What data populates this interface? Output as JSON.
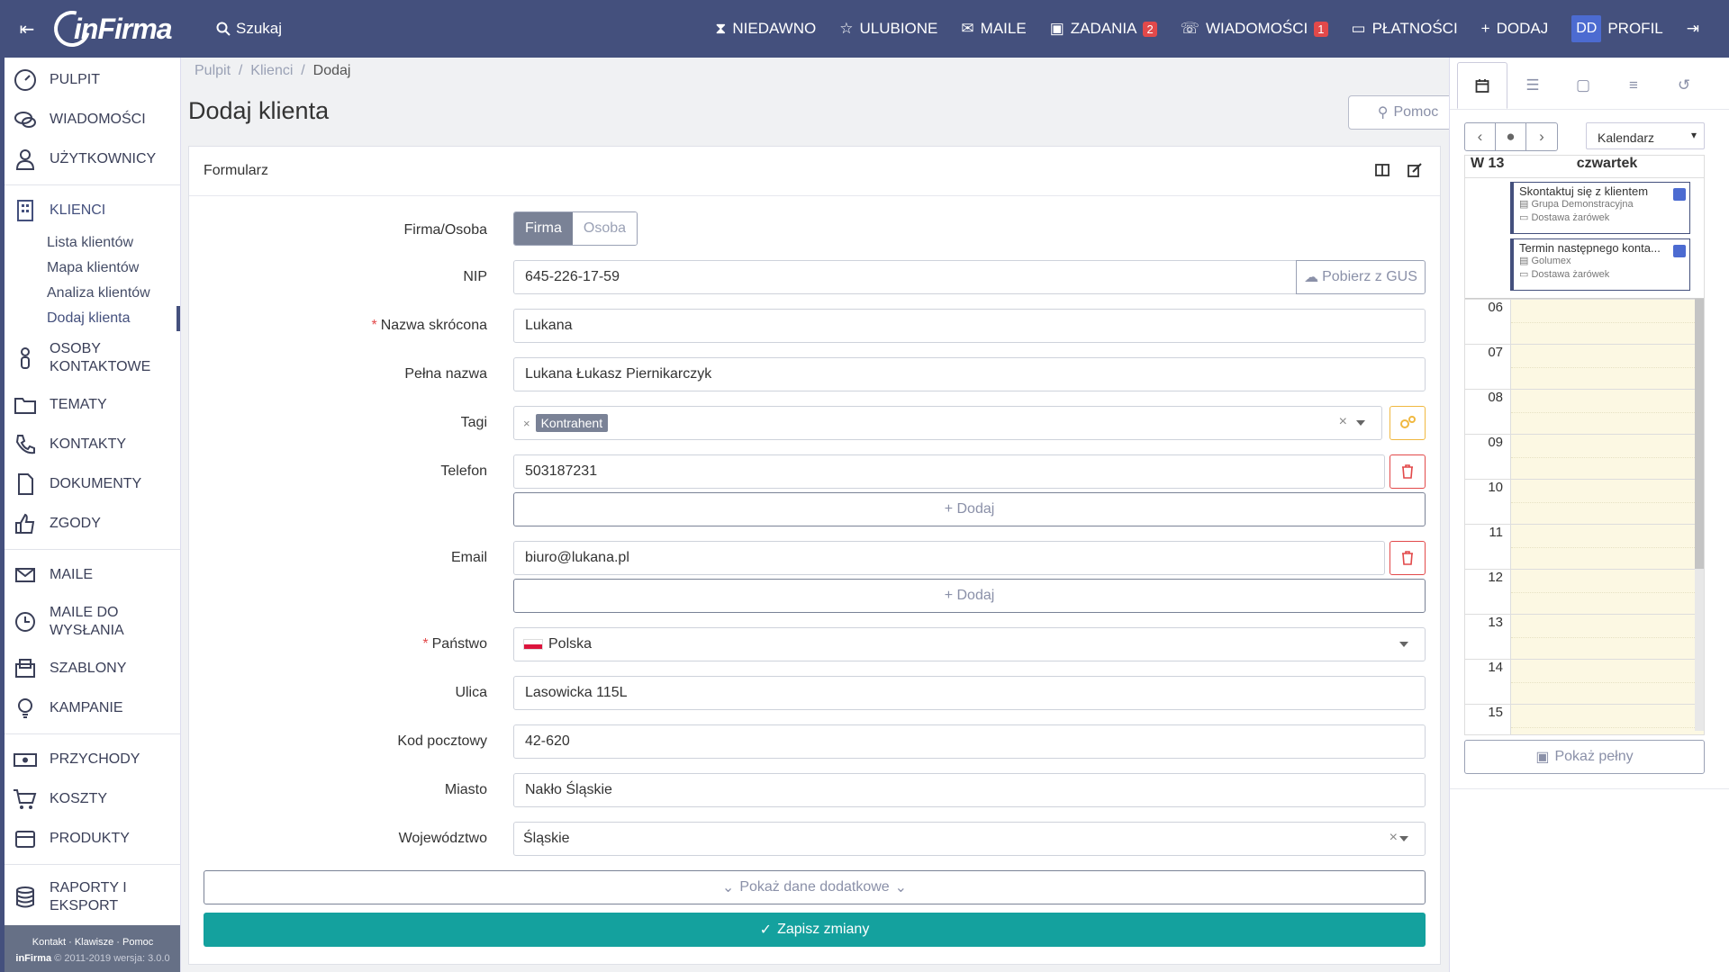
{
  "topbar": {
    "logo": "inFirma",
    "search": "Szukaj",
    "nav": [
      {
        "label": "NIEDAWNO",
        "icon": "hourglass-icon"
      },
      {
        "label": "ULUBIONE",
        "icon": "star-icon"
      },
      {
        "label": "MAILE",
        "icon": "envelope-icon"
      },
      {
        "label": "ZADANIA",
        "icon": "calendar-icon",
        "badge": "2"
      },
      {
        "label": "WIADOMOŚCI",
        "icon": "chat-icon",
        "badge": "1"
      },
      {
        "label": "PŁATNOŚCI",
        "icon": "credit-card-icon"
      },
      {
        "label": "DODAJ",
        "icon": "plus-icon"
      }
    ],
    "avatar": "DD",
    "profile": "PROFIL"
  },
  "sidebar": {
    "items": [
      {
        "label": "PULPIT",
        "icon": "dashboard-icon"
      },
      {
        "label": "WIADOMOŚCI",
        "icon": "chat-icon"
      },
      {
        "label": "UŻYTKOWNICY",
        "icon": "user-icon"
      },
      {
        "label": "KLIENCI",
        "icon": "building-icon"
      },
      {
        "label": "OSOBY KONTAKTOWE",
        "icon": "person-icon"
      },
      {
        "label": "TEMATY",
        "icon": "folder-icon"
      },
      {
        "label": "KONTAKTY",
        "icon": "phone-icon"
      },
      {
        "label": "DOKUMENTY",
        "icon": "document-icon"
      },
      {
        "label": "ZGODY",
        "icon": "thumbs-up-icon"
      },
      {
        "label": "MAILE",
        "icon": "envelope-icon"
      },
      {
        "label": "MAILE DO WYSŁANIA",
        "icon": "clock-icon"
      },
      {
        "label": "SZABLONY",
        "icon": "mail-template-icon"
      },
      {
        "label": "KAMPANIE",
        "icon": "lightbulb-icon"
      },
      {
        "label": "PRZYCHODY",
        "icon": "money-icon"
      },
      {
        "label": "KOSZTY",
        "icon": "cart-icon"
      },
      {
        "label": "PRODUKTY",
        "icon": "box-icon"
      },
      {
        "label": "RAPORTY I EKSPORT",
        "icon": "database-icon"
      }
    ],
    "sub": [
      "Lista klientów",
      "Mapa klientów",
      "Analiza klientów",
      "Dodaj klienta"
    ],
    "footer_links": "Kontakt · Klawisze · Pomoc",
    "footer_brand": "inFirma",
    "footer_copy": "© 2011-2019 wersja: 3.0.0"
  },
  "breadcrumb": [
    "Pulpit",
    "Klienci",
    "Dodaj"
  ],
  "page_title": "Dodaj klienta",
  "help_label": "Pomoc",
  "form": {
    "header": "Formularz",
    "type_label": "Firma/Osoba",
    "type_options": [
      "Firma",
      "Osoba"
    ],
    "nip_label": "NIP",
    "nip_value": "645-226-17-59",
    "gus_label": "Pobierz z GUS",
    "short_name_label": "Nazwa skrócona",
    "short_name_value": "Lukana",
    "full_name_label": "Pełna nazwa",
    "full_name_value": "Lukana Łukasz Piernikarczyk",
    "tags_label": "Tagi",
    "tag_value": "Kontrahent",
    "phone_label": "Telefon",
    "phone_value": "503187231",
    "add_label": "Dodaj",
    "email_label": "Email",
    "email_value": "biuro@lukana.pl",
    "country_label": "Państwo",
    "country_value": "Polska",
    "street_label": "Ulica",
    "street_value": "Lasowicka 115L",
    "postal_label": "Kod pocztowy",
    "postal_value": "42-620",
    "city_label": "Miasto",
    "city_value": "Nakło Śląskie",
    "region_label": "Województwo",
    "region_value": "Śląskie",
    "show_more": "Pokaż dane dodatkowe",
    "save": "Zapisz zmiany"
  },
  "calendar": {
    "view": "Kalendarz",
    "week": "W 13",
    "day": "czwartek",
    "events": [
      {
        "title": "Skontaktuj się z klientem",
        "company": "Grupa Demonstracyjna",
        "topic": "Dostawa żarówek"
      },
      {
        "title": "Termin następnego konta...",
        "company": "Golumex",
        "topic": "Dostawa żarówek"
      }
    ],
    "hours": [
      "06",
      "07",
      "08",
      "09",
      "10",
      "11",
      "12",
      "13",
      "14",
      "15"
    ],
    "show_full": "Pokaż pełny"
  },
  "colors": {
    "topbar": "#44507d",
    "save": "#14a19e",
    "danger": "#e2494a",
    "warning": "#f0b840"
  }
}
